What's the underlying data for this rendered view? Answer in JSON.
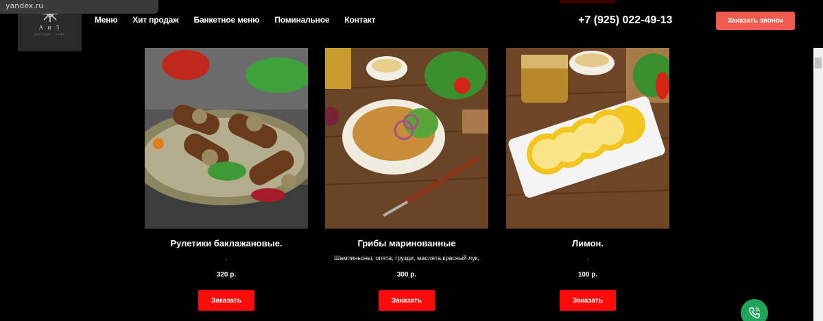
{
  "browser": {
    "status_url": "yandex.ru"
  },
  "header": {
    "logo_text": "А и З",
    "logo_sub": "ресторан · кафе",
    "nav": [
      {
        "label": "Меню"
      },
      {
        "label": "Хит продаж"
      },
      {
        "label": "Банкетное меню"
      },
      {
        "label": "Поминальное"
      },
      {
        "label": "Контакт"
      }
    ],
    "phone": "+7 (925) 022-49-13",
    "callback_label": "Заказать звонок"
  },
  "products": [
    {
      "title": "Рулетики баклажановые.",
      "description": ".",
      "price": "320 р.",
      "order_label": "Заказать"
    },
    {
      "title": "Грибы маринованные",
      "description": "Шампиньоны, опята, грузди, маслята,красный лук,",
      "price": "300 р.",
      "order_label": "Заказать"
    },
    {
      "title": "Лимон.",
      "description": ".",
      "price": "100 р.",
      "order_label": "Заказать"
    }
  ],
  "colors": {
    "accent": "#f05a4f",
    "order_button": "#ff0a0a",
    "call_fab": "#1fa45a",
    "background": "#000000"
  },
  "icons": {
    "fab": "phone-call-icon",
    "logo": "snowflake-emblem-icon"
  }
}
